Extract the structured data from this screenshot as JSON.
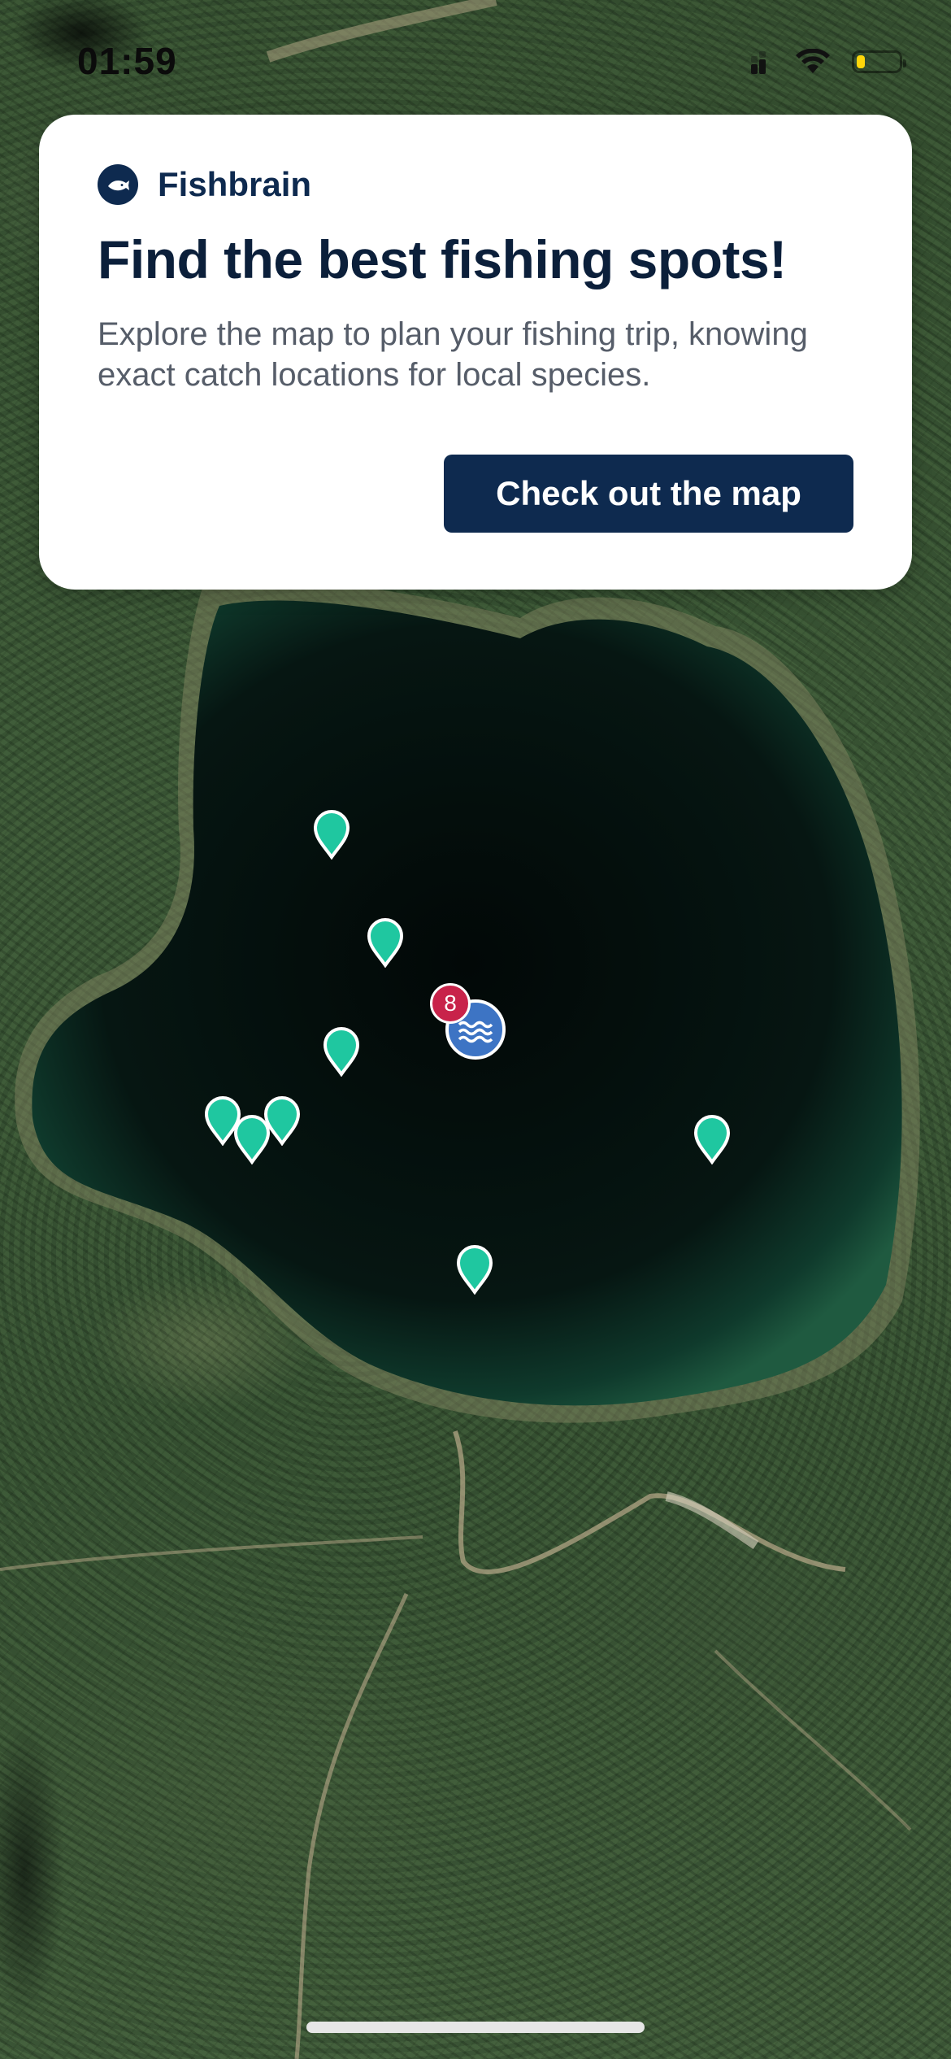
{
  "status_bar": {
    "time": "01:59",
    "battery_level": 0.2,
    "icons": [
      "cellular-signal-icon",
      "wifi-icon",
      "battery-icon"
    ]
  },
  "notification": {
    "app_name": "Fishbrain",
    "app_icon": "fishbrain-logo-icon",
    "title": "Find the best fishing spots!",
    "body": "Explore the map to plan your fishing trip, knowing exact catch locations for local species.",
    "cta_label": "Check out the map"
  },
  "map": {
    "type": "satellite",
    "catch_marker_count": 9,
    "cluster": {
      "count": "8",
      "icon": "water-waves-icon"
    },
    "colors": {
      "catch_marker": "#1fc7a0",
      "cluster_badge": "#c8234a",
      "water_pin": "#3d74c4",
      "brand_dark": "#0e2a4f"
    }
  }
}
